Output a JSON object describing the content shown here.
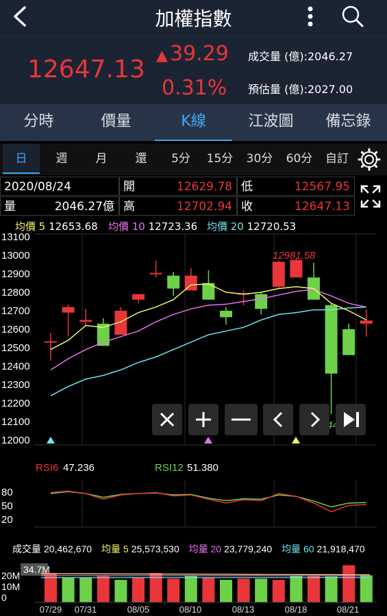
{
  "header": {
    "title": "加權指數",
    "back_icon": "chevron-left-icon",
    "more_icon": "more-vertical-icon",
    "search_icon": "search-icon"
  },
  "quote": {
    "price": "12647.13",
    "change": "39.29",
    "change_pct": "0.31%",
    "volume_label": "成交量 (億):2046.27",
    "estimate_label": "預估量 (億):2027.00",
    "up_color": "#e8363a"
  },
  "tabs": [
    "分時",
    "價量",
    "K線",
    "江波圖",
    "備忘錄"
  ],
  "active_tab": "K線",
  "periods": [
    "日",
    "週",
    "月",
    "還",
    "5分",
    "15分",
    "30分",
    "60分",
    "自訂"
  ],
  "active_period": "日",
  "info": {
    "date": "2020/08/24",
    "open_label": "開",
    "open": "12629.78",
    "low_label": "低",
    "low": "12567.95",
    "vol_label": "量",
    "vol": "2046.27億",
    "high_label": "高",
    "high": "12702.94",
    "close_label": "收",
    "close": "12647.13"
  },
  "ma_legend": {
    "ma5": "均價 5",
    "ma5_val": "12653.68",
    "ma10": "均價 10",
    "ma10_val": "12723.36",
    "ma20": "均價 20",
    "ma20_val": "12720.53"
  },
  "colors": {
    "ma5": "#f5f56a",
    "ma10": "#e86ff0",
    "ma20": "#6fe3f0",
    "up": "#e8363a",
    "down": "#6ed14a",
    "accent": "#3fa9f5"
  },
  "price_axis": [
    "13100",
    "13000",
    "12900",
    "12800",
    "12700",
    "12600",
    "12500",
    "12400",
    "12300",
    "12200",
    "12100",
    "12000"
  ],
  "annotations": {
    "max": "12981.58",
    "min": "12144.76"
  },
  "zoom_controls": [
    "close-icon",
    "zoom-in-icon",
    "zoom-out-icon",
    "prev-icon",
    "next-icon",
    "end-icon"
  ],
  "rsi": {
    "rsi6": "RSI6",
    "rsi6_val": "47.236",
    "rsi12": "RSI12",
    "rsi12_val": "51.380",
    "axis": [
      "80",
      "50",
      "20"
    ]
  },
  "volume": {
    "label": "成交量",
    "value": "20,462,670",
    "ma5": "均量 5",
    "ma5_val": "25,573,530",
    "ma20": "均量 20",
    "ma20_val": "23,779,240",
    "ma60": "均量 60",
    "ma60_val": "21,918,470",
    "axis_top": "34.7M",
    "axis": [
      "20M",
      "10M",
      "0"
    ]
  },
  "dates": [
    "07/29",
    "07/31",
    "08/05",
    "08/10",
    "08/13",
    "08/18",
    "08/21"
  ],
  "chart_data": {
    "type": "candlestick",
    "ylim": [
      12000,
      13100
    ],
    "candles": [
      {
        "o": 12530,
        "h": 12580,
        "l": 12430,
        "c": 12535
      },
      {
        "o": 12690,
        "h": 12735,
        "l": 12560,
        "c": 12720
      },
      {
        "o": 12640,
        "h": 12710,
        "l": 12620,
        "c": 12650
      },
      {
        "o": 12630,
        "h": 12660,
        "l": 12510,
        "c": 12510
      },
      {
        "o": 12570,
        "h": 12720,
        "l": 12570,
        "c": 12700
      },
      {
        "o": 12760,
        "h": 12790,
        "l": 12740,
        "c": 12790
      },
      {
        "o": 12900,
        "h": 12970,
        "l": 12880,
        "c": 12905
      },
      {
        "o": 12890,
        "h": 12910,
        "l": 12780,
        "c": 12820
      },
      {
        "o": 12810,
        "h": 12930,
        "l": 12810,
        "c": 12890
      },
      {
        "o": 12850,
        "h": 12920,
        "l": 12760,
        "c": 12760
      },
      {
        "o": 12700,
        "h": 12720,
        "l": 12625,
        "c": 12665
      },
      {
        "o": 12790,
        "h": 12810,
        "l": 12730,
        "c": 12795
      },
      {
        "o": 12790,
        "h": 12800,
        "l": 12680,
        "c": 12710
      },
      {
        "o": 12830,
        "h": 12970,
        "l": 12820,
        "c": 12965
      },
      {
        "o": 12880,
        "h": 12982,
        "l": 12880,
        "c": 12975
      },
      {
        "o": 12880,
        "h": 12960,
        "l": 12760,
        "c": 12760
      },
      {
        "o": 12730,
        "h": 12740,
        "l": 12140,
        "c": 12360
      },
      {
        "o": 12600,
        "h": 12630,
        "l": 12490,
        "c": 12460
      },
      {
        "o": 12630,
        "h": 12705,
        "l": 12560,
        "c": 12647
      }
    ],
    "ma5": [
      12490,
      12540,
      12620,
      12610,
      12640,
      12690,
      12720,
      12760,
      12840,
      12845,
      12800,
      12790,
      12800,
      12820,
      12830,
      12820,
      12740,
      12700,
      12650
    ],
    "ma10": [
      12380,
      12440,
      12490,
      12530,
      12560,
      12590,
      12640,
      12680,
      12710,
      12730,
      12735,
      12750,
      12765,
      12785,
      12805,
      12815,
      12780,
      12740,
      12720
    ],
    "ma20": [
      12240,
      12290,
      12330,
      12350,
      12380,
      12420,
      12450,
      12490,
      12530,
      12570,
      12590,
      12610,
      12650,
      12680,
      12690,
      12705,
      12705,
      12715,
      12720
    ],
    "rsi6": [
      72,
      75,
      70,
      58,
      67,
      70,
      72,
      65,
      67,
      58,
      50,
      57,
      55,
      70,
      64,
      50,
      32,
      45,
      47
    ],
    "rsi12": [
      70,
      74,
      70,
      62,
      68,
      70,
      71,
      67,
      68,
      60,
      55,
      59,
      58,
      67,
      64,
      54,
      42,
      50,
      51
    ],
    "vol": [
      26,
      22,
      22,
      24,
      20,
      22,
      26,
      21,
      24,
      22,
      20,
      21,
      21,
      20,
      24,
      24,
      23,
      33,
      24
    ],
    "vol_up": [
      true,
      false,
      false,
      true,
      false,
      true,
      true,
      true,
      false,
      true,
      false,
      true,
      false,
      true,
      false,
      true,
      false,
      true,
      false
    ]
  }
}
